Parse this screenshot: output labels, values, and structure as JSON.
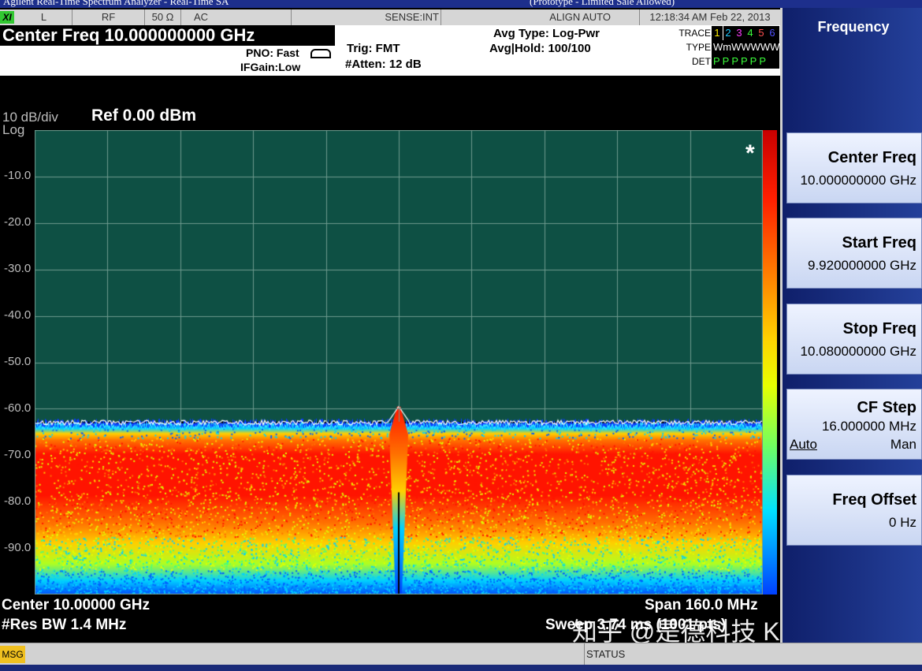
{
  "window": {
    "title": "Agilent Real-Time Spectrum Analyzer - Real-Time SA",
    "title_note": "(Prototype - Limited Sale Allowed)"
  },
  "status_bar": {
    "badge": "XI",
    "cells": [
      "L",
      "RF",
      "50 Ω",
      "AC",
      "SENSE:INT",
      "ALIGN AUTO",
      "12:18:34 AM Feb 22, 2013"
    ]
  },
  "header": {
    "center_freq": "Center Freq 10.000000000 GHz",
    "pno": "PNO: Fast",
    "ifgain": "IFGain:Low",
    "trig": "Trig: FMT",
    "atten": "#Atten: 12 dB",
    "avg_type": "Avg Type: Log-Pwr",
    "avg_hold": "Avg|Hold: 100/100",
    "trace_label": "TRACE",
    "type_label": "TYPE",
    "det_label": "DET",
    "trace_numbers": [
      "1",
      "2",
      "3",
      "4",
      "5",
      "6"
    ],
    "trace_colors": [
      "#ffee00",
      "#1ec8ff",
      "#ff3cff",
      "#3cff3c",
      "#ff5050",
      "#5050ff"
    ],
    "trace_types": "WmWWWWW",
    "trace_dets": "PPPPPP"
  },
  "display": {
    "scale": "10 dB/div",
    "scale_type": "Log",
    "ref_level": "Ref 0.00 dBm",
    "y_ticks": [
      "-10.0",
      "-20.0",
      "-30.0",
      "-40.0",
      "-50.0",
      "-60.0",
      "-70.0",
      "-80.0",
      "-90.0"
    ],
    "marker_flag": "*",
    "center": "Center 10.00000 GHz",
    "res_bw": "#Res BW 1.4 MHz",
    "span": "Span 160.0 MHz",
    "sweep": "Sweep 3.74 ms (1001 pts)",
    "watermark": "知乎 @是德科技 Keysigh…"
  },
  "message_bar": {
    "msg_label": "MSG",
    "status_label": "STATUS"
  },
  "softkeys": {
    "title": "Frequency",
    "items": [
      {
        "label": "Center Freq",
        "value": "10.000000000 GHz"
      },
      {
        "label": "Start Freq",
        "value": "9.920000000 GHz"
      },
      {
        "label": "Stop Freq",
        "value": "10.080000000 GHz"
      },
      {
        "label": "CF Step",
        "value": "16.000000 MHz",
        "auto": "Auto",
        "man": "Man"
      },
      {
        "label": "Freq Offset",
        "value": "0 Hz"
      }
    ]
  },
  "spectrum": {
    "ref_dbm": 0,
    "bottom_dbm": -100,
    "noise_floor_dbm": -64.5,
    "peak_dbm": -59.5,
    "peak_x_fraction": 0.5,
    "density_colors": [
      "#ff1400",
      "#ff7000",
      "#ffd000",
      "#e0ff00",
      "#40ff80",
      "#00d0ff",
      "#0060ff"
    ],
    "grid_color": "#6e9a8e",
    "background_color": "#0e5044"
  }
}
